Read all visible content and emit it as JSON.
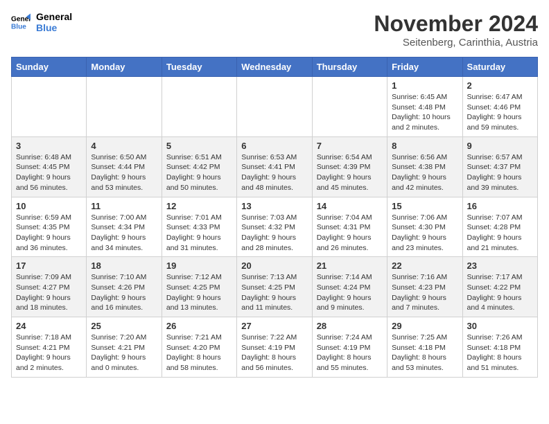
{
  "logo": {
    "line1": "General",
    "line2": "Blue"
  },
  "title": "November 2024",
  "subtitle": "Seitenberg, Carinthia, Austria",
  "days_of_week": [
    "Sunday",
    "Monday",
    "Tuesday",
    "Wednesday",
    "Thursday",
    "Friday",
    "Saturday"
  ],
  "weeks": [
    [
      {
        "day": "",
        "info": ""
      },
      {
        "day": "",
        "info": ""
      },
      {
        "day": "",
        "info": ""
      },
      {
        "day": "",
        "info": ""
      },
      {
        "day": "",
        "info": ""
      },
      {
        "day": "1",
        "info": "Sunrise: 6:45 AM\nSunset: 4:48 PM\nDaylight: 10 hours and 2 minutes."
      },
      {
        "day": "2",
        "info": "Sunrise: 6:47 AM\nSunset: 4:46 PM\nDaylight: 9 hours and 59 minutes."
      }
    ],
    [
      {
        "day": "3",
        "info": "Sunrise: 6:48 AM\nSunset: 4:45 PM\nDaylight: 9 hours and 56 minutes."
      },
      {
        "day": "4",
        "info": "Sunrise: 6:50 AM\nSunset: 4:44 PM\nDaylight: 9 hours and 53 minutes."
      },
      {
        "day": "5",
        "info": "Sunrise: 6:51 AM\nSunset: 4:42 PM\nDaylight: 9 hours and 50 minutes."
      },
      {
        "day": "6",
        "info": "Sunrise: 6:53 AM\nSunset: 4:41 PM\nDaylight: 9 hours and 48 minutes."
      },
      {
        "day": "7",
        "info": "Sunrise: 6:54 AM\nSunset: 4:39 PM\nDaylight: 9 hours and 45 minutes."
      },
      {
        "day": "8",
        "info": "Sunrise: 6:56 AM\nSunset: 4:38 PM\nDaylight: 9 hours and 42 minutes."
      },
      {
        "day": "9",
        "info": "Sunrise: 6:57 AM\nSunset: 4:37 PM\nDaylight: 9 hours and 39 minutes."
      }
    ],
    [
      {
        "day": "10",
        "info": "Sunrise: 6:59 AM\nSunset: 4:35 PM\nDaylight: 9 hours and 36 minutes."
      },
      {
        "day": "11",
        "info": "Sunrise: 7:00 AM\nSunset: 4:34 PM\nDaylight: 9 hours and 34 minutes."
      },
      {
        "day": "12",
        "info": "Sunrise: 7:01 AM\nSunset: 4:33 PM\nDaylight: 9 hours and 31 minutes."
      },
      {
        "day": "13",
        "info": "Sunrise: 7:03 AM\nSunset: 4:32 PM\nDaylight: 9 hours and 28 minutes."
      },
      {
        "day": "14",
        "info": "Sunrise: 7:04 AM\nSunset: 4:31 PM\nDaylight: 9 hours and 26 minutes."
      },
      {
        "day": "15",
        "info": "Sunrise: 7:06 AM\nSunset: 4:30 PM\nDaylight: 9 hours and 23 minutes."
      },
      {
        "day": "16",
        "info": "Sunrise: 7:07 AM\nSunset: 4:28 PM\nDaylight: 9 hours and 21 minutes."
      }
    ],
    [
      {
        "day": "17",
        "info": "Sunrise: 7:09 AM\nSunset: 4:27 PM\nDaylight: 9 hours and 18 minutes."
      },
      {
        "day": "18",
        "info": "Sunrise: 7:10 AM\nSunset: 4:26 PM\nDaylight: 9 hours and 16 minutes."
      },
      {
        "day": "19",
        "info": "Sunrise: 7:12 AM\nSunset: 4:25 PM\nDaylight: 9 hours and 13 minutes."
      },
      {
        "day": "20",
        "info": "Sunrise: 7:13 AM\nSunset: 4:25 PM\nDaylight: 9 hours and 11 minutes."
      },
      {
        "day": "21",
        "info": "Sunrise: 7:14 AM\nSunset: 4:24 PM\nDaylight: 9 hours and 9 minutes."
      },
      {
        "day": "22",
        "info": "Sunrise: 7:16 AM\nSunset: 4:23 PM\nDaylight: 9 hours and 7 minutes."
      },
      {
        "day": "23",
        "info": "Sunrise: 7:17 AM\nSunset: 4:22 PM\nDaylight: 9 hours and 4 minutes."
      }
    ],
    [
      {
        "day": "24",
        "info": "Sunrise: 7:18 AM\nSunset: 4:21 PM\nDaylight: 9 hours and 2 minutes."
      },
      {
        "day": "25",
        "info": "Sunrise: 7:20 AM\nSunset: 4:21 PM\nDaylight: 9 hours and 0 minutes."
      },
      {
        "day": "26",
        "info": "Sunrise: 7:21 AM\nSunset: 4:20 PM\nDaylight: 8 hours and 58 minutes."
      },
      {
        "day": "27",
        "info": "Sunrise: 7:22 AM\nSunset: 4:19 PM\nDaylight: 8 hours and 56 minutes."
      },
      {
        "day": "28",
        "info": "Sunrise: 7:24 AM\nSunset: 4:19 PM\nDaylight: 8 hours and 55 minutes."
      },
      {
        "day": "29",
        "info": "Sunrise: 7:25 AM\nSunset: 4:18 PM\nDaylight: 8 hours and 53 minutes."
      },
      {
        "day": "30",
        "info": "Sunrise: 7:26 AM\nSunset: 4:18 PM\nDaylight: 8 hours and 51 minutes."
      }
    ]
  ]
}
